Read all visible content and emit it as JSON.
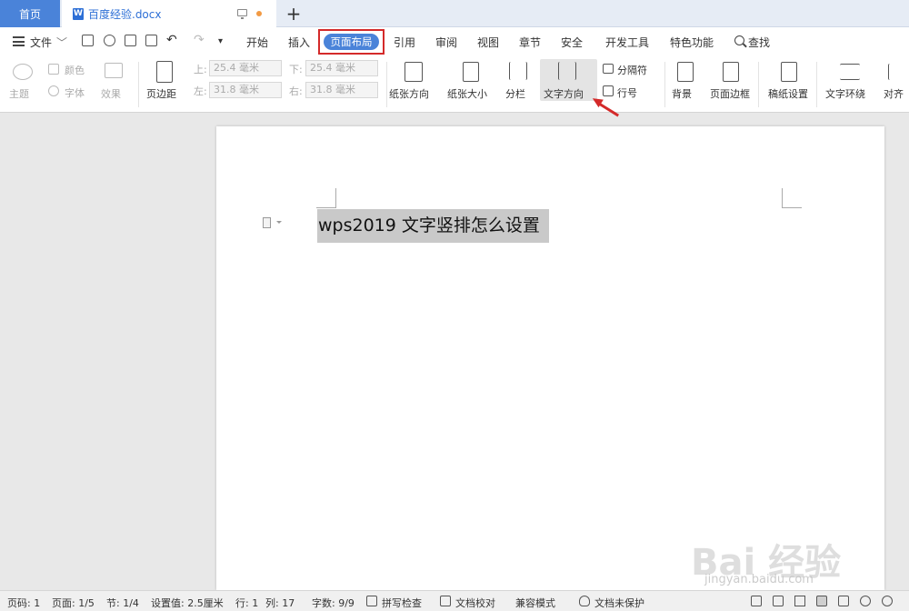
{
  "tabs": {
    "home": "首页",
    "doc_name": "百度经验.docx",
    "doc_icon_letter": "W",
    "add_tab": "+"
  },
  "menu": {
    "file": "文件",
    "items": [
      "开始",
      "插入",
      "页面布局",
      "引用",
      "审阅",
      "视图",
      "章节",
      "安全",
      "开发工具",
      "特色功能"
    ],
    "search": "查找"
  },
  "ribbon": {
    "theme": "主题",
    "colors": "颜色",
    "fonts": "字体",
    "effects": "效果",
    "margins": "页边距",
    "top_label": "上:",
    "top_value": "25.4 毫米",
    "bottom_label": "下:",
    "bottom_value": "25.4 毫米",
    "left_label": "左:",
    "left_value": "31.8 毫米",
    "right_label": "右:",
    "right_value": "31.8 毫米",
    "orientation": "纸张方向",
    "size": "纸张大小",
    "columns": "分栏",
    "text_direction": "文字方向",
    "breaks": "分隔符",
    "line_numbers": "行号",
    "background": "背景",
    "page_border": "页面边框",
    "grid_paper": "稿纸设置",
    "text_wrap": "文字环绕",
    "align": "对齐"
  },
  "document": {
    "text": "wps2019 文字竖排怎么设置"
  },
  "watermark": {
    "main": "Bai 经验",
    "sub": "jingyan.baidu.com"
  },
  "status": {
    "page_num": "页码: 1",
    "pages": "页面: 1/5",
    "section": "节: 1/4",
    "setting": "设置值: 2.5厘米",
    "row": "行: 1",
    "col": "列: 17",
    "word_count": "字数: 9/9",
    "spell_check": "拼写检查",
    "doc_proof": "文档校对",
    "compat": "兼容模式",
    "protect": "文档未保护"
  },
  "colors": {
    "accent": "#4a83d9",
    "highlight_box": "#d42a2a",
    "selection": "#c9c9c9"
  }
}
